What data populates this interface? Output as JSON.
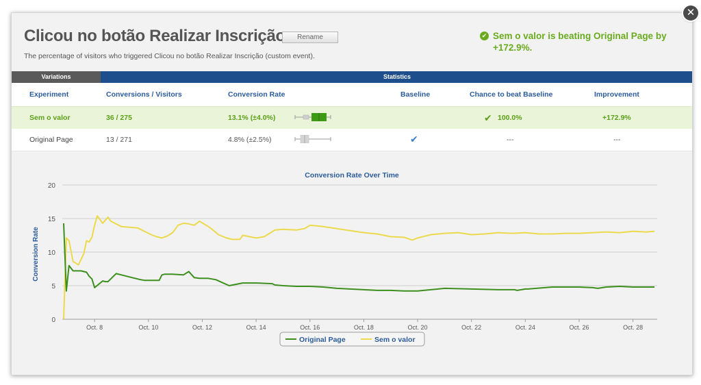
{
  "header": {
    "title": "Clicou no botão Realizar Inscrição",
    "rename_label": "Rename",
    "subtitle": "The percentage of visitors who triggered Clicou no botão Realizar Inscrição (custom event).",
    "winner_message": "Sem o valor is beating Original Page by +172.9%."
  },
  "tabs": {
    "variations": "Variations",
    "statistics": "Statistics"
  },
  "table": {
    "columns": [
      "Experiment",
      "Conversions / Visitors",
      "Conversion Rate",
      "Baseline",
      "Chance to beat Baseline",
      "Improvement"
    ],
    "rows": [
      {
        "name": "Sem o valor",
        "conversions": "36 / 275",
        "rate": "13.1% (±4.0%)",
        "rate_value": 13.1,
        "rate_margin": 4.0,
        "baseline": "",
        "chance": "100.0%",
        "improvement": "+172.9%",
        "highlight_color": "#5b9f18"
      },
      {
        "name": "Original Page",
        "conversions": "13 / 271",
        "rate": "4.8% (±2.5%)",
        "rate_value": 4.8,
        "rate_margin": 2.5,
        "baseline": "check-icon",
        "chance": "---",
        "improvement": "---",
        "highlight_color": "#555555"
      }
    ]
  },
  "chart_data": {
    "type": "line",
    "title": "Conversion Rate Over Time",
    "xlabel": "",
    "ylabel": "Conversion Rate",
    "ylim": [
      0,
      20
    ],
    "yticks": [
      0,
      5,
      10,
      15,
      20
    ],
    "x_tick_labels": [
      "Oct. 8",
      "Oct. 10",
      "Oct. 12",
      "Oct. 14",
      "Oct. 16",
      "Oct. 18",
      "Oct. 20",
      "Oct. 22",
      "Oct. 24",
      "Oct. 26",
      "Oct. 28"
    ],
    "x_tick_days": [
      8,
      10,
      12,
      14,
      16,
      18,
      20,
      22,
      24,
      26,
      28
    ],
    "xlim": [
      6.8,
      28.9
    ],
    "grid": true,
    "legend_placement": "bottom-center",
    "series": [
      {
        "name": "Original Page",
        "color": "#3c8f1c",
        "x": [
          6.85,
          6.95,
          7.05,
          7.2,
          7.5,
          7.7,
          7.8,
          7.9,
          8.0,
          8.3,
          8.4,
          8.5,
          8.8,
          9.0,
          9.3,
          9.7,
          9.85,
          10.4,
          10.5,
          10.6,
          10.9,
          11.3,
          11.5,
          11.7,
          11.9,
          12.2,
          12.5,
          13.0,
          13.5,
          14.0,
          14.6,
          14.7,
          15.0,
          15.5,
          16.0,
          16.5,
          17.0,
          17.5,
          18.0,
          18.5,
          19.0,
          19.5,
          19.6,
          20.0,
          21.0,
          22.0,
          23.0,
          23.6,
          23.7,
          24.0,
          24.1,
          25.0,
          26.0,
          26.5,
          26.7,
          27.0,
          27.5,
          28.0,
          28.8
        ],
        "y": [
          14.3,
          4.2,
          8.0,
          7.2,
          7.2,
          7.0,
          6.4,
          6.0,
          4.7,
          5.7,
          5.6,
          5.6,
          6.8,
          6.6,
          6.3,
          5.9,
          5.8,
          5.8,
          6.6,
          6.7,
          6.7,
          6.6,
          7.1,
          6.2,
          6.1,
          6.1,
          5.9,
          5.0,
          5.4,
          5.4,
          5.3,
          5.1,
          5.0,
          4.9,
          4.9,
          4.8,
          4.6,
          4.5,
          4.4,
          4.3,
          4.3,
          4.2,
          4.2,
          4.2,
          4.6,
          4.5,
          4.4,
          4.4,
          4.3,
          4.5,
          4.5,
          4.8,
          4.8,
          4.7,
          4.6,
          4.8,
          4.9,
          4.8,
          4.8
        ]
      },
      {
        "name": "Sem o valor",
        "color": "#ecd94c",
        "x": [
          6.85,
          6.95,
          7.05,
          7.2,
          7.4,
          7.6,
          7.7,
          7.8,
          7.9,
          8.0,
          8.1,
          8.3,
          8.5,
          8.6,
          8.8,
          9.0,
          9.3,
          9.6,
          9.9,
          10.1,
          10.3,
          10.5,
          10.7,
          10.9,
          11.1,
          11.3,
          11.5,
          11.7,
          11.9,
          12.3,
          12.6,
          12.9,
          13.1,
          13.4,
          13.5,
          14.0,
          14.3,
          14.5,
          14.7,
          15.0,
          15.5,
          15.8,
          16.0,
          16.5,
          17.0,
          17.5,
          18.0,
          18.5,
          19.0,
          19.5,
          19.8,
          20.0,
          20.5,
          21.0,
          21.5,
          22.0,
          22.5,
          23.0,
          23.5,
          24.0,
          24.5,
          25.0,
          25.5,
          26.0,
          26.5,
          27.0,
          27.5,
          28.0,
          28.5,
          28.8
        ],
        "y": [
          0.0,
          12.1,
          11.7,
          8.6,
          8.1,
          9.8,
          11.7,
          11.5,
          12.2,
          14.0,
          15.4,
          14.3,
          15.2,
          14.6,
          14.2,
          13.8,
          13.7,
          13.6,
          13.0,
          12.6,
          12.3,
          12.1,
          12.4,
          12.9,
          14.0,
          14.3,
          14.2,
          14.0,
          14.6,
          13.6,
          12.6,
          12.1,
          11.9,
          11.9,
          12.5,
          12.1,
          12.3,
          12.8,
          13.3,
          13.4,
          13.3,
          13.5,
          14.0,
          13.8,
          13.5,
          13.2,
          12.9,
          12.7,
          12.3,
          12.2,
          11.8,
          12.1,
          12.6,
          12.8,
          12.9,
          12.6,
          12.7,
          12.9,
          12.8,
          12.9,
          12.7,
          12.7,
          12.8,
          12.8,
          12.9,
          13.0,
          12.9,
          13.1,
          13.0,
          13.1
        ]
      }
    ]
  }
}
